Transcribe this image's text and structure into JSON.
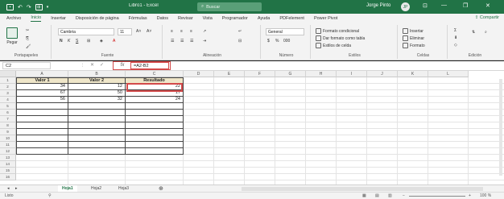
{
  "window": {
    "quick_access": [
      "save",
      "undo",
      "redo",
      "customize"
    ],
    "title": "Libro1 - Excel",
    "search_placeholder": "Buscar",
    "user": "Jorge Pinto",
    "avatar_initials": "JP",
    "controls": [
      "—",
      "❐",
      "✕"
    ]
  },
  "ribbon_tabs": [
    "Archivo",
    "Inicio",
    "Insertar",
    "Disposición de página",
    "Fórmulas",
    "Datos",
    "Revisar",
    "Vista",
    "Programador",
    "Ayuda",
    "PDFelement",
    "Power Pivot"
  ],
  "active_tab": "Inicio",
  "share_label": "Compartir",
  "ribbon": {
    "clipboard": {
      "paste": "Pegar",
      "label": "Portapapeles"
    },
    "font": {
      "name": "Cambria",
      "size": "11",
      "label": "Fuente",
      "bold": "N",
      "italic": "K",
      "underline": "S"
    },
    "alignment": {
      "label": "Alineación"
    },
    "number": {
      "format": "General",
      "label": "Número"
    },
    "styles": {
      "cond": "Formato condicional",
      "table": "Dar formato como tabla",
      "cell": "Estilos de celda",
      "label": "Estilos"
    },
    "cells": {
      "insert": "Insertar",
      "delete": "Eliminar",
      "format": "Formato",
      "label": "Celdas"
    },
    "editing": {
      "label": "Edición"
    }
  },
  "formula_bar": {
    "name_box": "C2",
    "fx": "fx",
    "formula": "=A2-B2"
  },
  "grid": {
    "columns": [
      "A",
      "B",
      "C",
      "D",
      "E",
      "F",
      "G",
      "H",
      "I",
      "J",
      "K",
      "L"
    ],
    "rows": [
      "1",
      "2",
      "3",
      "4",
      "5",
      "6",
      "7",
      "8",
      "9",
      "10",
      "11",
      "12",
      "13",
      "14",
      "15",
      "16"
    ]
  },
  "table": {
    "headers": [
      "Valor 1",
      "Valor 2",
      "Resultado"
    ],
    "rows": [
      [
        "34",
        "12",
        "22"
      ],
      [
        "67",
        "50",
        "17"
      ],
      [
        "56",
        "32",
        "24"
      ]
    ]
  },
  "sheets": [
    "Hoja1",
    "Hoja2",
    "Hoja3"
  ],
  "active_sheet": "Hoja1",
  "status": {
    "mode": "Listo",
    "zoom": "100 %"
  }
}
